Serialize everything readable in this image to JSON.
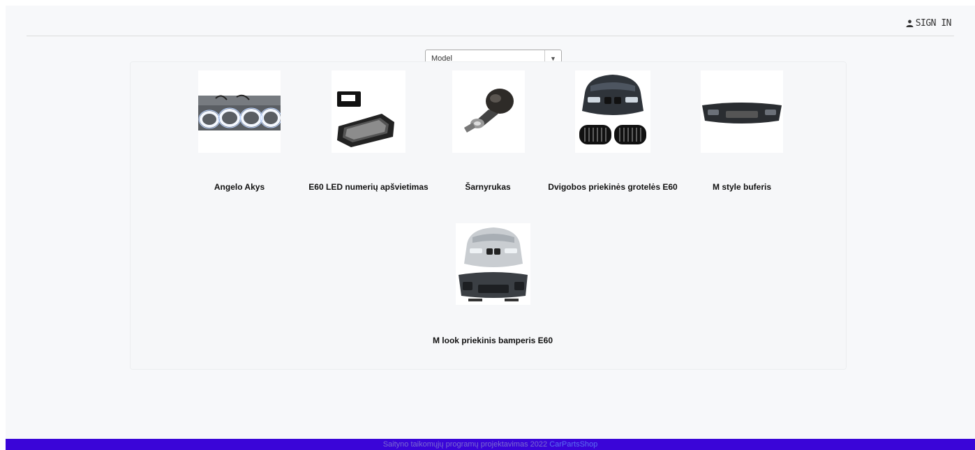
{
  "header": {
    "signin_label": "SIGN IN"
  },
  "filter": {
    "model_select_value": "Model"
  },
  "products": [
    {
      "title": "Angelo Akys"
    },
    {
      "title": "E60 LED numerių apšvietimas"
    },
    {
      "title": "Šarnyrukas"
    },
    {
      "title": "Dvigobos priekinės grotelės E60"
    },
    {
      "title": "M style buferis"
    },
    {
      "title": "M look priekinis bamperis E60"
    }
  ],
  "footer": {
    "text": "Saityno taikomųjų programų projektavimas 2022",
    "brand": "CarPartsShop"
  },
  "colors": {
    "footer_bg": "#3a05d8",
    "page_bg": "#f7f8fa"
  }
}
